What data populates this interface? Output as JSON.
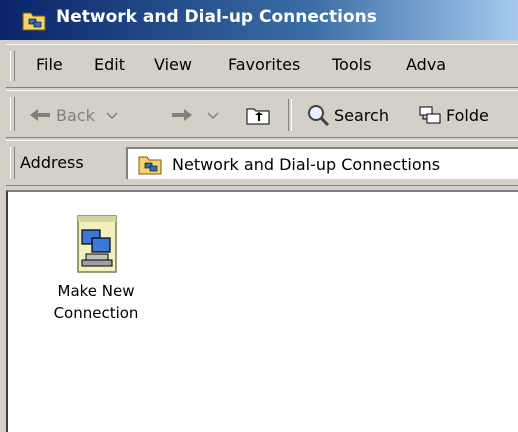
{
  "window": {
    "title": "Network and Dial-up Connections"
  },
  "menubar": {
    "items": [
      "File",
      "Edit",
      "View",
      "Favorites",
      "Tools",
      "Adva"
    ]
  },
  "toolbar": {
    "back_label": "Back",
    "search_label": "Search",
    "folders_label": "Folde"
  },
  "address": {
    "label": "Address",
    "value": "Network and Dial-up Connections"
  },
  "content": {
    "items": [
      {
        "label": "Make New\nConnection",
        "icon": "make-new-connection-icon"
      }
    ]
  },
  "colors": {
    "titlebar_start": "#0a246a",
    "titlebar_end": "#a6caf0",
    "chrome": "#d4d0c8"
  }
}
